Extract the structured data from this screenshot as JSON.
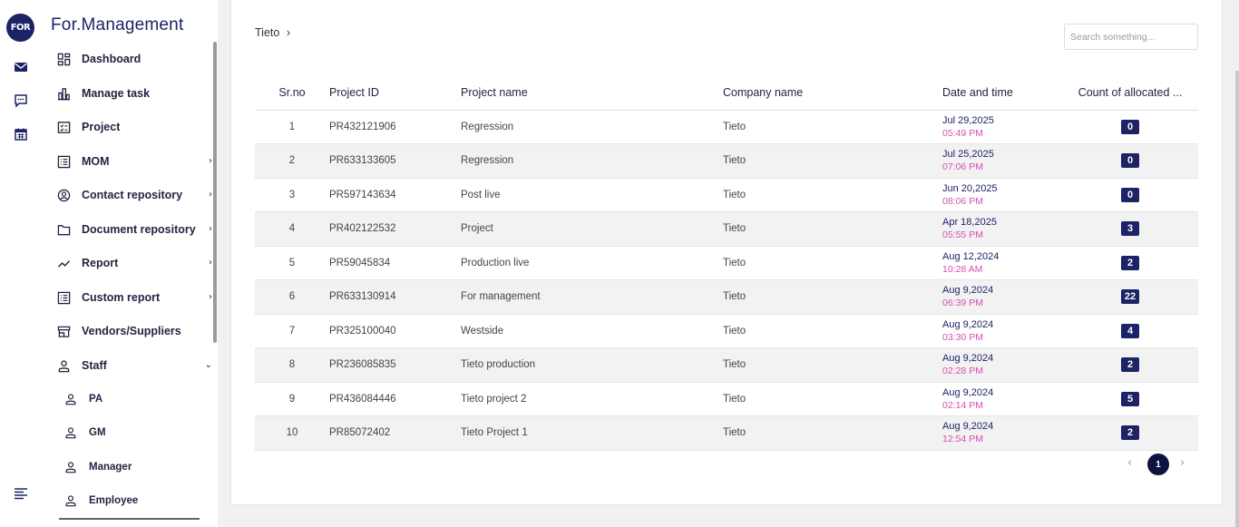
{
  "app": {
    "logo_text": "FOR",
    "brand": "For.Management"
  },
  "rail": {
    "icons": [
      "mail-icon",
      "chat-icon",
      "calendar-icon",
      "menu-icon"
    ]
  },
  "sidebar": {
    "items": [
      {
        "label": "Dashboard",
        "icon": "dashboard-icon",
        "chevron": ""
      },
      {
        "label": "Manage task",
        "icon": "bar-chart-icon",
        "chevron": ""
      },
      {
        "label": "Project",
        "icon": "project-icon",
        "chevron": ""
      },
      {
        "label": "MOM",
        "icon": "list-icon",
        "chevron": "›"
      },
      {
        "label": "Contact repository",
        "icon": "contact-icon",
        "chevron": "›"
      },
      {
        "label": "Document repository",
        "icon": "folder-icon",
        "chevron": "›"
      },
      {
        "label": "Report",
        "icon": "trend-icon",
        "chevron": "›"
      },
      {
        "label": "Custom report",
        "icon": "list-icon",
        "chevron": "›"
      },
      {
        "label": "Vendors/Suppliers",
        "icon": "store-icon",
        "chevron": ""
      },
      {
        "label": "Staff",
        "icon": "person-icon",
        "chevron": "⌄"
      }
    ],
    "staff_sub": [
      {
        "label": "PA"
      },
      {
        "label": "GM"
      },
      {
        "label": "Manager"
      },
      {
        "label": "Employee"
      }
    ]
  },
  "main": {
    "breadcrumb": "Tieto",
    "breadcrumb_sep": "›",
    "search_placeholder": "Search something...",
    "table": {
      "headers": {
        "sr": "Sr.no",
        "id": "Project ID",
        "name": "Project name",
        "company": "Company name",
        "datetime": "Date and time",
        "count": "Count of allocated ..."
      },
      "rows": [
        {
          "sr": "1",
          "id": "PR432121906",
          "name": "Regression",
          "company": "Tieto",
          "date": "Jul 29,2025",
          "time": "05:49 PM",
          "count": "0"
        },
        {
          "sr": "2",
          "id": "PR633133605",
          "name": "Regression",
          "company": "Tieto",
          "date": "Jul 25,2025",
          "time": "07:06 PM",
          "count": "0"
        },
        {
          "sr": "3",
          "id": "PR597143634",
          "name": "Post live",
          "company": "Tieto",
          "date": "Jun 20,2025",
          "time": "08:06 PM",
          "count": "0"
        },
        {
          "sr": "4",
          "id": "PR402122532",
          "name": "Project",
          "company": "Tieto",
          "date": "Apr 18,2025",
          "time": "05:55 PM",
          "count": "3"
        },
        {
          "sr": "5",
          "id": "PR59045834",
          "name": "Production live",
          "company": "Tieto",
          "date": "Aug 12,2024",
          "time": "10:28 AM",
          "count": "2"
        },
        {
          "sr": "6",
          "id": "PR633130914",
          "name": "For management",
          "company": "Tieto",
          "date": "Aug 9,2024",
          "time": "06:39 PM",
          "count": "22"
        },
        {
          "sr": "7",
          "id": "PR325100040",
          "name": "Westside",
          "company": "Tieto",
          "date": "Aug 9,2024",
          "time": "03:30 PM",
          "count": "4"
        },
        {
          "sr": "8",
          "id": "PR236085835",
          "name": "Tieto production",
          "company": "Tieto",
          "date": "Aug 9,2024",
          "time": "02:28 PM",
          "count": "2"
        },
        {
          "sr": "9",
          "id": "PR436084446",
          "name": "Tieto project 2",
          "company": "Tieto",
          "date": "Aug 9,2024",
          "time": "02:14 PM",
          "count": "5"
        },
        {
          "sr": "10",
          "id": "PR85072402",
          "name": "Tieto Project 1",
          "company": "Tieto",
          "date": "Aug 9,2024",
          "time": "12:54 PM",
          "count": "2"
        }
      ]
    },
    "pagination": {
      "prev": "‹",
      "current": "1",
      "next": "›"
    }
  },
  "colors": {
    "primary": "#1c2366",
    "time_accent": "#d64fb0",
    "row_alt": "#f2f2f3"
  }
}
